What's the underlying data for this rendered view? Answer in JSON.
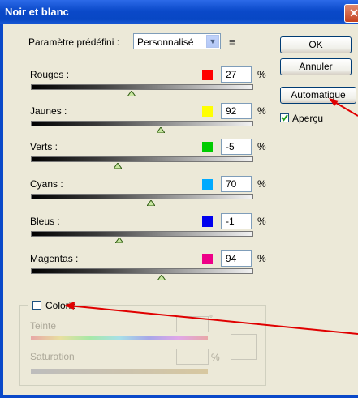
{
  "window": {
    "title": "Noir et blanc",
    "close_symbol": "✕"
  },
  "preset": {
    "label": "Paramètre prédéfini :",
    "value": "Personnalisé",
    "menu_icon": "list-menu-icon"
  },
  "buttons": {
    "ok": "OK",
    "cancel": "Annuler",
    "auto": "Automatique"
  },
  "preview": {
    "label": "Aperçu",
    "checked": true
  },
  "channels": [
    {
      "label": "Rouges :",
      "value": "27",
      "unit": "%",
      "color": "#ff0000",
      "level": 0.27
    },
    {
      "label": "Jaunes :",
      "value": "92",
      "unit": "%",
      "color": "#ffff00",
      "level": 0.92
    },
    {
      "label": "Verts :",
      "value": "-5",
      "unit": "%",
      "color": "#00cc00",
      "level": -0.05
    },
    {
      "label": "Cyans :",
      "value": "70",
      "unit": "%",
      "color": "#00aaff",
      "level": 0.7
    },
    {
      "label": "Bleus :",
      "value": "-1",
      "unit": "%",
      "color": "#0000ee",
      "level": -0.01
    },
    {
      "label": "Magentas :",
      "value": "94",
      "unit": "%",
      "color": "#ee0088",
      "level": 0.94
    }
  ],
  "colorize": {
    "label": "Coloris",
    "checked": false,
    "hue_label": "Teinte",
    "hue_unit": "°",
    "saturation_label": "Saturation",
    "saturation_unit": "%"
  },
  "annotations": {
    "arrow_color": "#e00000"
  }
}
